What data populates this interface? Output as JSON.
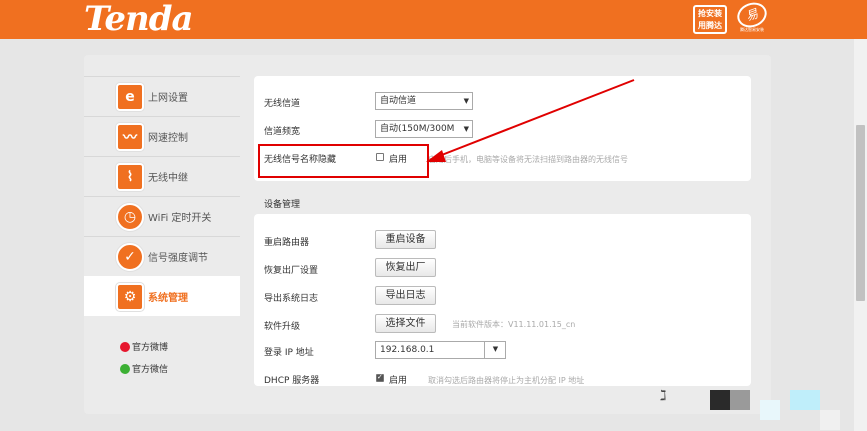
{
  "header": {
    "logo": "Tenda",
    "badge_install": [
      "抢安装",
      "用腾达"
    ],
    "badge_brand_small": "腾达智易安装"
  },
  "sidebar": {
    "items": [
      {
        "label": "上网设置",
        "icon": "internet-explorer-icon"
      },
      {
        "label": "网速控制",
        "icon": "speed-wave-icon"
      },
      {
        "label": "无线中继",
        "icon": "wireless-repeater-icon"
      },
      {
        "label": "WiFi 定时开关",
        "icon": "timer-icon"
      },
      {
        "label": "信号强度调节",
        "icon": "signal-strength-icon"
      },
      {
        "label": "系统管理",
        "icon": "gear-icon",
        "active": true
      }
    ],
    "social": [
      {
        "label": "官方微博",
        "icon": "weibo-icon"
      },
      {
        "label": "官方微信",
        "icon": "wechat-icon"
      }
    ]
  },
  "wireless": {
    "channel_label": "无线信道",
    "channel_value": "自动信道",
    "bandwidth_label": "信道频宽",
    "bandwidth_value": "自动(150M/300M",
    "hide_ssid_label": "无线信号名称隐藏",
    "hide_ssid_checkbox_label": "启用",
    "hide_ssid_checked": false,
    "hide_ssid_hint": "启用后手机，电脑等设备将无法扫描到路由器的无线信号"
  },
  "device_mgmt": {
    "title": "设备管理",
    "reboot_label": "重启路由器",
    "reboot_button": "重启设备",
    "reset_label": "恢复出厂设置",
    "reset_button": "恢复出厂",
    "export_log_label": "导出系统日志",
    "export_log_button": "导出日志",
    "upgrade_label": "软件升级",
    "upgrade_button": "选择文件",
    "upgrade_hint": "当前软件版本：V11.11.01.15_cn",
    "login_ip_label": "登录 IP 地址",
    "login_ip_value": "192.168.0.1",
    "dhcp_label": "DHCP 服务器",
    "dhcp_checkbox_label": "启用",
    "dhcp_checked": true,
    "dhcp_hint": "取消勾选后路由器将停止为主机分配 IP 地址"
  },
  "colors": {
    "brand": "#f07020",
    "highlight_box": "#e00000"
  }
}
